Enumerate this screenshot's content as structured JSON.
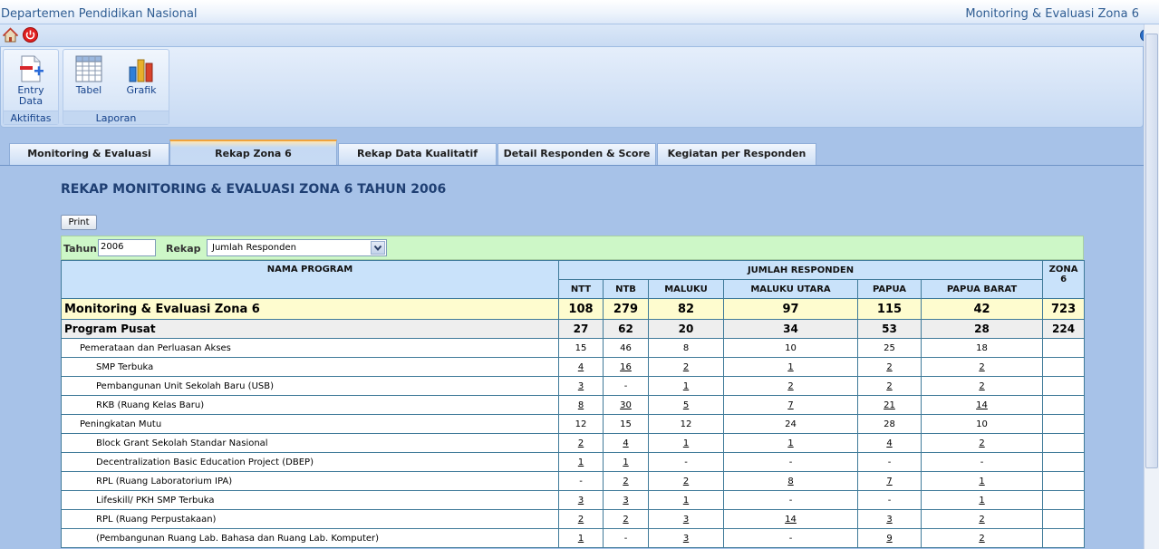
{
  "window": {
    "left_title": "Departemen Pendidikan Nasional",
    "right_title": "Monitoring & Evaluasi Zona 6"
  },
  "quick_access": {
    "icons": [
      "home-icon",
      "power-icon",
      "help-icon"
    ]
  },
  "ribbon": {
    "groups": [
      {
        "caption": "Aktifitas",
        "buttons": [
          {
            "label": "Entry Data",
            "icon": "entry-data-icon"
          }
        ]
      },
      {
        "caption": "Laporan",
        "buttons": [
          {
            "label": "Tabel",
            "icon": "table-icon"
          },
          {
            "label": "Grafik",
            "icon": "bar-chart-icon"
          }
        ]
      }
    ]
  },
  "tabs": [
    {
      "label": "Monitoring & Evaluasi",
      "active": false
    },
    {
      "label": "Rekap Zona 6",
      "active": true
    },
    {
      "label": "Rekap Data Kualitatif",
      "active": false
    },
    {
      "label": "Detail Responden & Score",
      "active": false
    },
    {
      "label": "Kegiatan per Responden",
      "active": false
    }
  ],
  "report": {
    "title": "REKAP MONITORING & EVALUASI ZONA 6 TAHUN 2006",
    "print_label": "Print",
    "filter": {
      "tahun_label": "Tahun",
      "tahun_value": "2006",
      "rekap_label": "Rekap",
      "rekap_value": "Jumlah Responden"
    },
    "headers": {
      "nama_program": "NAMA PROGRAM",
      "jumlah_responden": "JUMLAH RESPONDEN",
      "zona": "ZONA 6",
      "regions": [
        "NTT",
        "NTB",
        "MALUKU",
        "MALUKU UTARA",
        "PAPUA",
        "PAPUA BARAT"
      ]
    },
    "rows": [
      {
        "level": "total",
        "name": "Monitoring & Evaluasi Zona 6",
        "values": [
          "108",
          "279",
          "82",
          "97",
          "115",
          "42"
        ],
        "zona": "723"
      },
      {
        "level": "pusat",
        "name": "Program Pusat",
        "values": [
          "27",
          "62",
          "20",
          "34",
          "53",
          "28"
        ],
        "zona": "224"
      },
      {
        "level": "l1",
        "name": "Pemerataan dan Perluasan Akses",
        "values": [
          "15",
          "46",
          "8",
          "10",
          "25",
          "18"
        ],
        "zona": ""
      },
      {
        "level": "l2",
        "name": "SMP Terbuka",
        "values": [
          "4",
          "16",
          "2",
          "1",
          "2",
          "2"
        ],
        "zona": ""
      },
      {
        "level": "l2",
        "name": "Pembangunan Unit Sekolah Baru (USB)",
        "values": [
          "3",
          "-",
          "1",
          "2",
          "2",
          "2"
        ],
        "zona": ""
      },
      {
        "level": "l2",
        "name": "RKB (Ruang Kelas Baru)",
        "values": [
          "8",
          "30",
          "5",
          "7",
          "21",
          "14"
        ],
        "zona": ""
      },
      {
        "level": "l1",
        "name": "Peningkatan Mutu",
        "values": [
          "12",
          "15",
          "12",
          "24",
          "28",
          "10"
        ],
        "zona": ""
      },
      {
        "level": "l2",
        "name": "Block Grant Sekolah Standar Nasional",
        "values": [
          "2",
          "4",
          "1",
          "1",
          "4",
          "2"
        ],
        "zona": ""
      },
      {
        "level": "l2",
        "name": " Decentralization Basic Education Project (DBEP)",
        "values": [
          "1",
          "1",
          "-",
          "-",
          "-",
          "-"
        ],
        "zona": ""
      },
      {
        "level": "l2",
        "name": "RPL (Ruang Laboratorium IPA)",
        "values": [
          "-",
          "2",
          "2",
          "8",
          "7",
          "1"
        ],
        "zona": ""
      },
      {
        "level": "l2",
        "name": "Lifeskill/ PKH SMP Terbuka",
        "values": [
          "3",
          "3",
          "1",
          "-",
          "-",
          "1"
        ],
        "zona": ""
      },
      {
        "level": "l2",
        "name": "RPL (Ruang Perpustakaan)",
        "values": [
          "2",
          "2",
          "3",
          "14",
          "3",
          "2"
        ],
        "zona": ""
      },
      {
        "level": "l2",
        "name": "(Pembangunan Ruang Lab. Bahasa dan Ruang Lab. Komputer)",
        "values": [
          "1",
          "-",
          "3",
          "-",
          "9",
          "2"
        ],
        "zona": ""
      }
    ]
  }
}
